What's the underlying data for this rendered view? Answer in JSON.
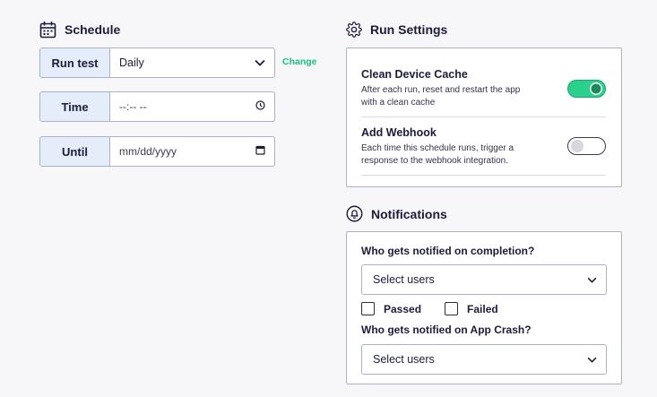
{
  "schedule": {
    "title": "Schedule",
    "icon": "calendar-icon",
    "run_test_label": "Run test",
    "run_test_value": "Daily",
    "change_label": "Change",
    "time_label": "Time",
    "time_value": "--:-- --",
    "until_label": "Until",
    "until_value": "mm/dd/yyyy"
  },
  "run_settings": {
    "title": "Run Settings",
    "icon": "gear-icon",
    "items": [
      {
        "title": "Clean Device Cache",
        "description": "After each run, reset and restart the app with a clean cache",
        "enabled": true
      },
      {
        "title": "Add Webhook",
        "description": "Each time this schedule runs, trigger a response to the webhook integration.",
        "enabled": false
      }
    ]
  },
  "notifications": {
    "title": "Notifications",
    "icon": "bell-icon",
    "completion_question": "Who gets notified on completion?",
    "completion_select": "Select users",
    "passed_label": "Passed",
    "passed_checked": false,
    "failed_label": "Failed",
    "failed_checked": false,
    "crash_question": "Who gets notified on App Crash?",
    "crash_select": "Select users"
  },
  "colors": {
    "accent_green": "#2ad18c",
    "link_green": "#1bbf7e",
    "label_bg": "#e4edf9",
    "border": "#a9b3c2",
    "text": "#1c1c3a"
  }
}
